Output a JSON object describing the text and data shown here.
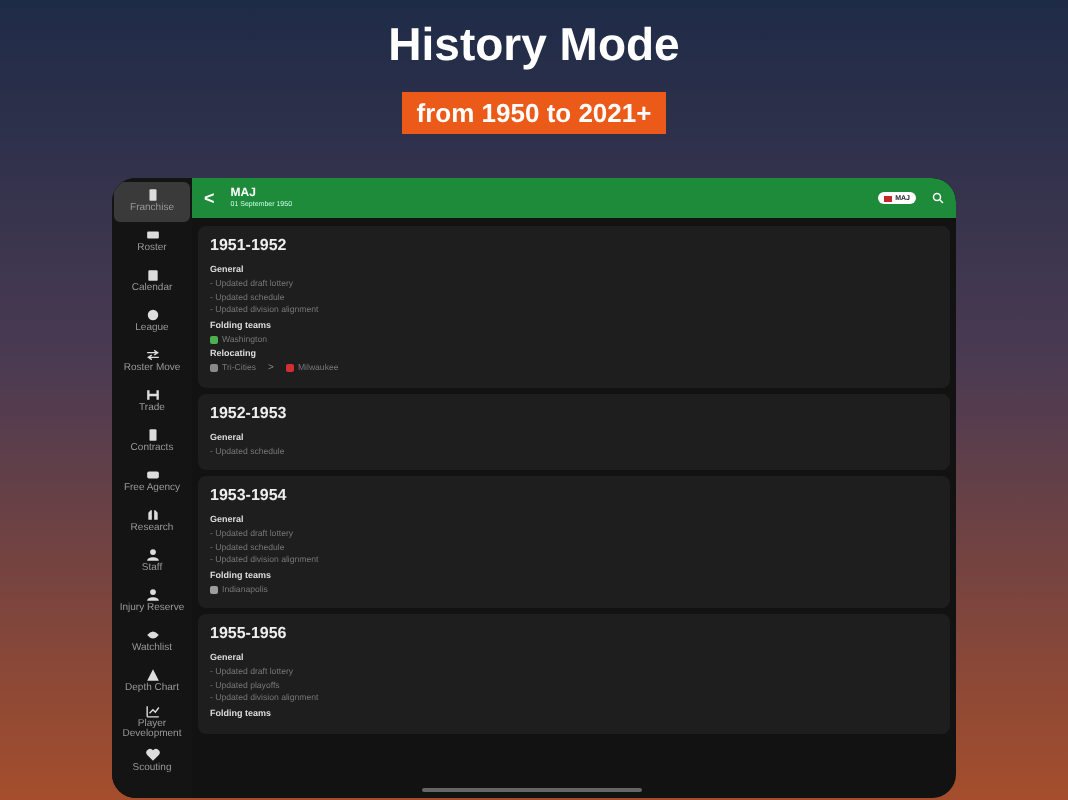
{
  "headline": "History Mode",
  "tagline": "from 1950 to 2021+",
  "sidebar": {
    "items": [
      {
        "label": "Franchise",
        "selected": true
      },
      {
        "label": "Roster",
        "selected": false
      },
      {
        "label": "Calendar",
        "selected": false
      },
      {
        "label": "League",
        "selected": false
      },
      {
        "label": "Roster Move",
        "selected": false
      },
      {
        "label": "Trade",
        "selected": false
      },
      {
        "label": "Contracts",
        "selected": false
      },
      {
        "label": "Free Agency",
        "selected": false
      },
      {
        "label": "Research",
        "selected": false
      },
      {
        "label": "Staff",
        "selected": false
      },
      {
        "label": "Injury Reserve",
        "selected": false
      },
      {
        "label": "Watchlist",
        "selected": false
      },
      {
        "label": "Depth Chart",
        "selected": false
      },
      {
        "label": "Player Development",
        "selected": false
      },
      {
        "label": "Scouting",
        "selected": false
      }
    ]
  },
  "header": {
    "back": "<",
    "title": "MAJ",
    "subtitle": "01 September 1950",
    "badge": "MAJ"
  },
  "seasons": [
    {
      "title": "1951-1952",
      "sections": [
        {
          "heading": "General",
          "kind": "list",
          "items": [
            {
              "text": "- Updated draft lottery"
            },
            {
              "text": "- Updated schedule"
            },
            {
              "text": "- Updated division alignment"
            }
          ]
        },
        {
          "heading": "Folding teams",
          "kind": "teams",
          "items": [
            {
              "text": "Washington",
              "color": "#4caf50"
            }
          ]
        },
        {
          "heading": "Relocating",
          "kind": "relocation",
          "items": [
            {
              "text": "Tri-Cities",
              "color": "#8a8a8a"
            },
            {
              "text": "Milwaukee",
              "color": "#d32f2f"
            }
          ],
          "arrow": ">"
        }
      ]
    },
    {
      "title": "1952-1953",
      "sections": [
        {
          "heading": "General",
          "kind": "list",
          "items": [
            {
              "text": "- Updated schedule"
            }
          ]
        }
      ]
    },
    {
      "title": "1953-1954",
      "sections": [
        {
          "heading": "General",
          "kind": "list",
          "items": [
            {
              "text": "- Updated draft lottery"
            },
            {
              "text": "- Updated schedule"
            },
            {
              "text": "- Updated division alignment"
            }
          ]
        },
        {
          "heading": "Folding teams",
          "kind": "teams",
          "items": [
            {
              "text": "Indianapolis",
              "color": "#9e9e9e"
            }
          ]
        }
      ]
    },
    {
      "title": "1955-1956",
      "sections": [
        {
          "heading": "General",
          "kind": "list",
          "items": [
            {
              "text": "- Updated draft lottery"
            },
            {
              "text": "- Updated playoffs"
            },
            {
              "text": "- Updated division alignment"
            }
          ]
        },
        {
          "heading": "Folding teams",
          "kind": "heading"
        }
      ]
    }
  ]
}
